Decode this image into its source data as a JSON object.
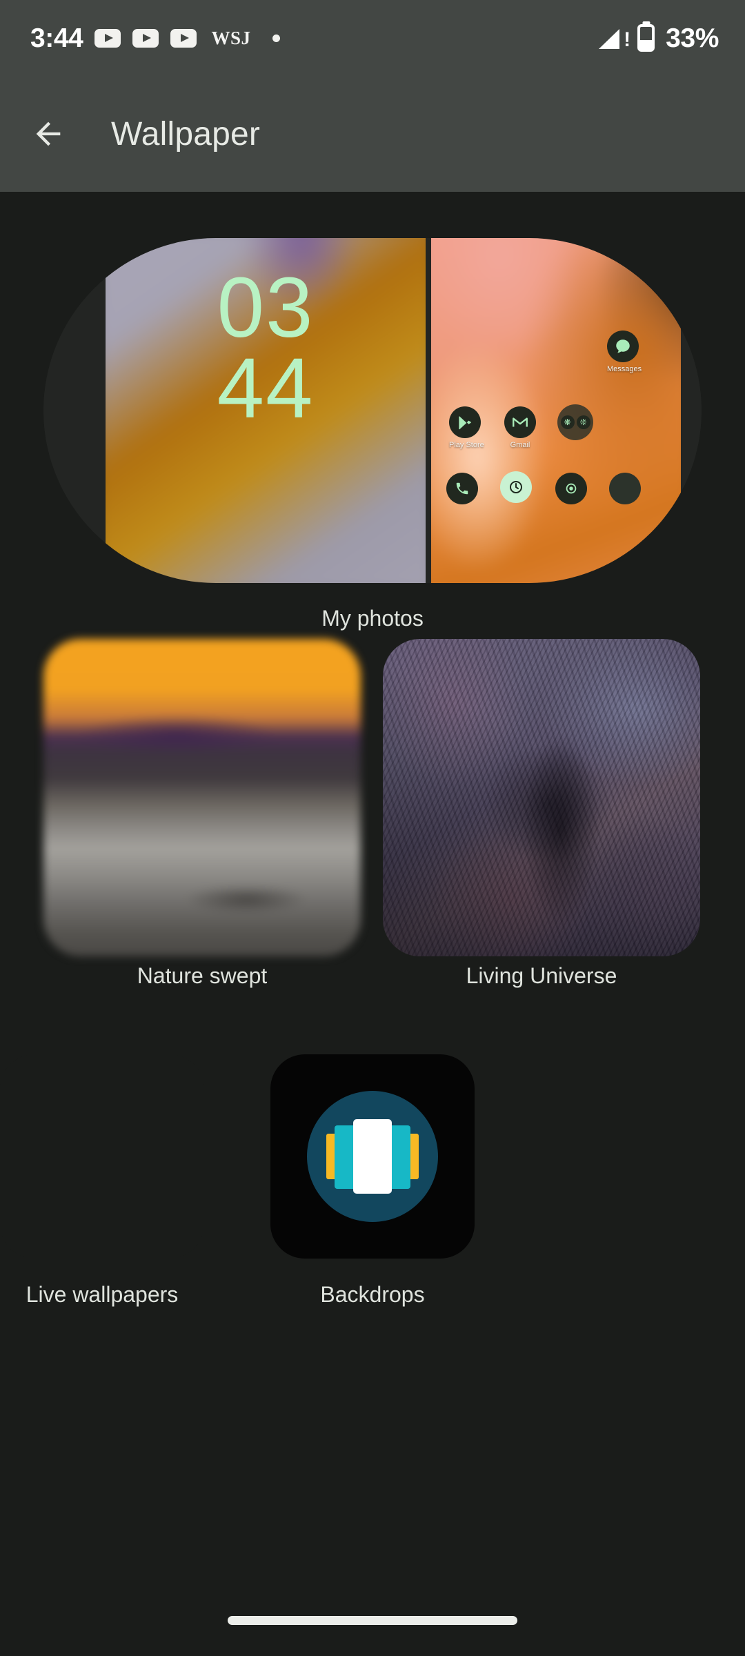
{
  "status_bar": {
    "time": "3:44",
    "notification_icons": [
      "youtube-icon",
      "youtube-icon",
      "youtube-icon"
    ],
    "wsj_label": "WSJ",
    "overflow_dot": "more-notifications-dot",
    "signal_icon": "cellular-signal-no-service-icon",
    "battery_icon": "battery-icon",
    "battery_percent": "33%",
    "background_color": "#434744",
    "foreground_color": "#ffffff"
  },
  "app_bar": {
    "back_icon": "arrow-back-icon",
    "title": "Wallpaper",
    "background_color": "#434744",
    "title_color": "#e7eae5"
  },
  "wallpaper_options": {
    "hero": {
      "label": "My photos",
      "lock_preview": {
        "clock_hours": "03",
        "clock_minutes": "44",
        "clock_color": "#b8f2c3"
      },
      "home_preview": {
        "apps": [
          {
            "name": "Messages",
            "label": "Messages",
            "icon": "messages-icon"
          },
          {
            "name": "Play Store",
            "label": "Play Store",
            "icon": "play-store-icon"
          },
          {
            "name": "Gmail",
            "label": "Gmail",
            "icon": "gmail-icon"
          },
          {
            "name": "Folder",
            "label": "",
            "icon": "app-folder-icon"
          }
        ]
      }
    },
    "items": [
      {
        "label": "Nature swept",
        "thumbnail": "nature-swept-thumbnail"
      },
      {
        "label": "Living Universe",
        "thumbnail": "living-universe-thumbnail"
      },
      {
        "label": "Live wallpapers",
        "thumbnail": "live-wallpapers-thumbnail"
      },
      {
        "label": "Backdrops",
        "thumbnail": "backdrops-app-icon"
      }
    ]
  },
  "nav_bar": {
    "gesture_pill": "home-gesture-pill"
  },
  "theme": {
    "page_background": "#1a1c1a",
    "caption_color": "#dfe3dd",
    "accent_green": "#a9ecb9"
  }
}
